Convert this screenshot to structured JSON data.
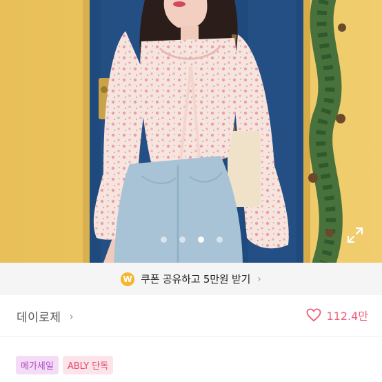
{
  "photo": {
    "description_icon": "product-photo",
    "carousel": {
      "count": 4,
      "active_index": 2
    },
    "expand_icon": "expand-icon"
  },
  "coupon": {
    "badge": "W",
    "text": "쿠폰 공유하고 5만원 받기",
    "chevron": "›"
  },
  "brand": {
    "name": "데이로제",
    "chevron": "›"
  },
  "likes": {
    "count": "112.4만",
    "icon": "heart-outline-icon",
    "color": "#ec5e79"
  },
  "tags": [
    {
      "label": "메가세일"
    },
    {
      "label": "ABLY 단독"
    }
  ]
}
